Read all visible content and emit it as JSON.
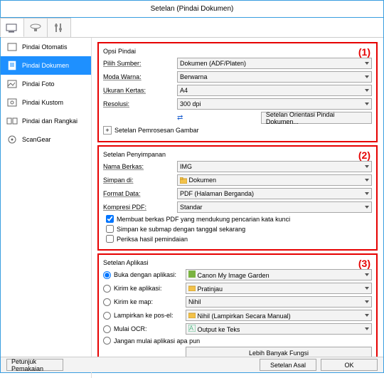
{
  "window": {
    "title": "Setelan (Pindai Dokumen)"
  },
  "nav": {
    "items": [
      {
        "label": "Pindai Otomatis"
      },
      {
        "label": "Pindai Dokumen"
      },
      {
        "label": "Pindai Foto"
      },
      {
        "label": "Pindai Kustom"
      },
      {
        "label": "Pindai dan Rangkai"
      },
      {
        "label": "ScanGear"
      }
    ]
  },
  "section1": {
    "num": "(1)",
    "title": "Opsi Pindai",
    "source_label": "Pilih Sumber:",
    "source_value": "Dokumen (ADF/Platen)",
    "color_label": "Moda Warna:",
    "color_value": "Berwarna",
    "paper_label": "Ukuran Kertas:",
    "paper_value": "A4",
    "res_label": "Resolusi:",
    "res_value": "300 dpi",
    "orient_btn": "Setelan Orientasi Pindai Dokumen...",
    "proc_btn": "Setelan Pemrosesan Gambar"
  },
  "section2": {
    "num": "(2)",
    "title": "Setelan Penyimpanan",
    "fname_label": "Nama Berkas:",
    "fname_value": "IMG",
    "save_label": "Simpan di:",
    "save_value": "Dokumen",
    "fmt_label": "Format Data:",
    "fmt_value": "PDF (Halaman Berganda)",
    "comp_label": "Kompresi PDF:",
    "comp_value": "Standar",
    "chk1": "Membuat berkas PDF yang mendukung pencarian kata kunci",
    "chk2": "Simpan ke submap dengan tanggal sekarang",
    "chk3": "Periksa hasil pemindaian"
  },
  "section3": {
    "num": "(3)",
    "title": "Setelan Aplikasi",
    "r1_label": "Buka dengan aplikasi:",
    "r1_value": "Canon My Image Garden",
    "r2_label": "Kirim ke aplikasi:",
    "r2_value": "Pratinjau",
    "r3_label": "Kirim ke map:",
    "r3_value": "Nihil",
    "r4_label": "Lampirkan ke pos-el:",
    "r4_value": "Nihil (Lampirkan Secara Manual)",
    "r5_label": "Mulai OCR:",
    "r5_value": "Output ke Teks",
    "r6_label": "Jangan mulai aplikasi apa pun",
    "more_btn": "Lebih Banyak Fungsi"
  },
  "footer": {
    "instructions": "Petunjuk Pemakaian",
    "defaults": "Setelan Asal",
    "ok": "OK"
  }
}
